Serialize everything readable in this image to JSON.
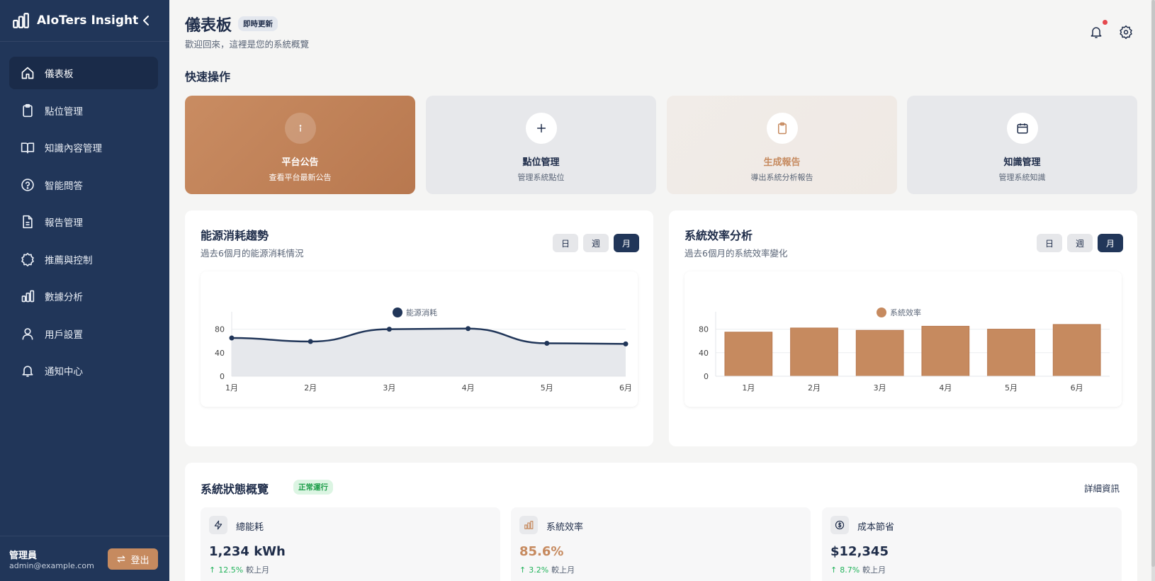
{
  "app": {
    "name": "AIoTers Insight"
  },
  "sidebar": {
    "items": [
      {
        "label": "儀表板",
        "icon": "home-icon",
        "active": true
      },
      {
        "label": "點位管理",
        "icon": "clipboard-icon"
      },
      {
        "label": "知識內容管理",
        "icon": "book-icon"
      },
      {
        "label": "智能問答",
        "icon": "help-circle-icon"
      },
      {
        "label": "報告管理",
        "icon": "file-text-icon"
      },
      {
        "label": "推薦與控制",
        "icon": "cog-icon"
      },
      {
        "label": "數據分析",
        "icon": "bar-chart-icon"
      },
      {
        "label": "用戶設置",
        "icon": "user-icon"
      },
      {
        "label": "通知中心",
        "icon": "bell-icon"
      }
    ],
    "user": {
      "name": "管理員",
      "email": "admin@example.com"
    },
    "logout_label": "登出"
  },
  "header": {
    "title": "儀表板",
    "badge": "即時更新",
    "subtitle": "歡迎回來，這裡是您的系統概覽"
  },
  "quick_actions": {
    "title": "快速操作",
    "items": [
      {
        "title": "平台公告",
        "desc": "查看平台最新公告"
      },
      {
        "title": "點位管理",
        "desc": "管理系統點位"
      },
      {
        "title": "生成報告",
        "desc": "導出系統分析報告"
      },
      {
        "title": "知識管理",
        "desc": "管理系統知識"
      }
    ]
  },
  "periods": [
    "日",
    "週",
    "月"
  ],
  "energy_chart": {
    "title": "能源消耗趨勢",
    "subtitle": "過去6個月的能源消耗情況"
  },
  "efficiency_chart": {
    "title": "系統效率分析",
    "subtitle": "過去6個月的系統效率變化"
  },
  "chart_data": [
    {
      "type": "area",
      "categories": [
        "1月",
        "2月",
        "3月",
        "4月",
        "5月",
        "6月"
      ],
      "series": [
        {
          "name": "能源消耗",
          "values": [
            65,
            59,
            80,
            81,
            56,
            55
          ],
          "color": "#213659"
        }
      ],
      "yticks": [
        0,
        40,
        80
      ],
      "ylim": [
        0,
        100
      ],
      "legend": "top-center"
    },
    {
      "type": "bar",
      "categories": [
        "1月",
        "2月",
        "3月",
        "4月",
        "5月",
        "6月"
      ],
      "series": [
        {
          "name": "系統效率",
          "values": [
            75,
            82,
            78,
            85,
            80,
            88
          ],
          "color": "#c68a5f"
        }
      ],
      "yticks": [
        0,
        40,
        80
      ],
      "ylim": [
        0,
        100
      ],
      "legend": "top-center"
    }
  ],
  "status": {
    "title": "系統狀態概覽",
    "badge": "正常運行",
    "detail_link": "詳細資訊",
    "metrics": [
      {
        "label": "總能耗",
        "value": "1,234 kWh",
        "change": "12.5%",
        "compare": "較上月",
        "icon": "zap-icon"
      },
      {
        "label": "系統效率",
        "value": "85.6%",
        "change": "3.2%",
        "compare": "較上月",
        "icon": "bar-chart-icon"
      },
      {
        "label": "成本節省",
        "value": "$12,345",
        "change": "8.7%",
        "compare": "較上月",
        "icon": "dollar-icon"
      }
    ]
  },
  "colors": {
    "navy": "#213659",
    "accent": "#c68a5f",
    "success": "#22b35b"
  }
}
